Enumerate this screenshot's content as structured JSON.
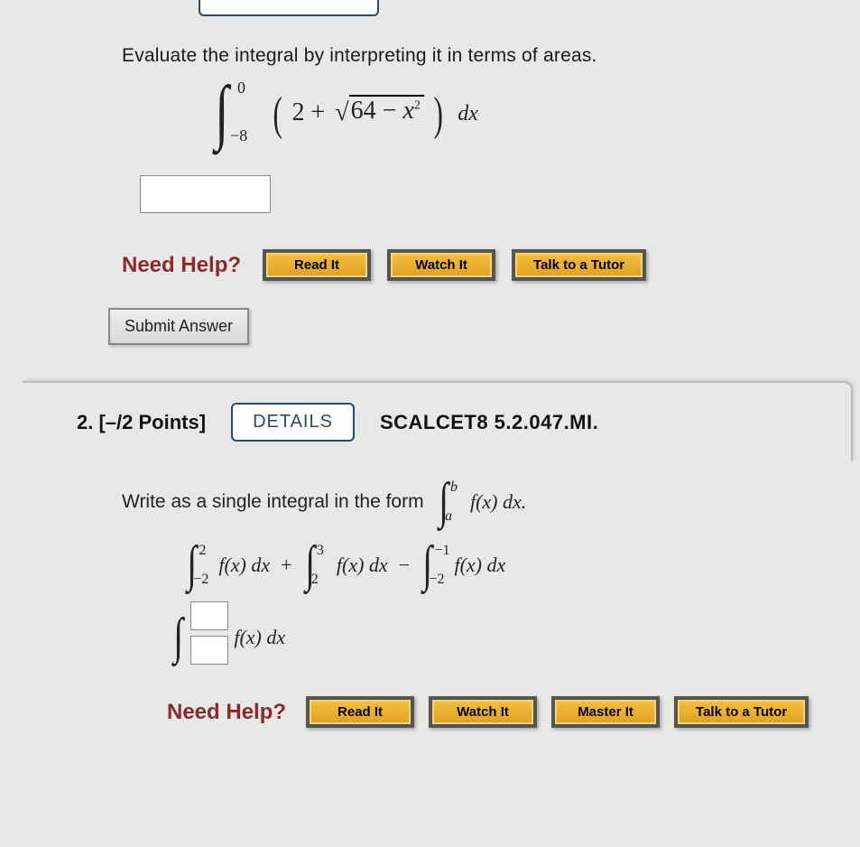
{
  "q1": {
    "prompt": "Evaluate the integral by interpreting it in terms of areas.",
    "integral": {
      "lower": "−8",
      "upper": "0",
      "const": "2",
      "plus": "+",
      "radicand_a": "64",
      "minus": "−",
      "radicand_var": "x",
      "radicand_exp": "2",
      "dx": "dx"
    },
    "need_help_label": "Need Help?",
    "buttons": {
      "read": "Read It",
      "watch": "Watch It",
      "tutor": "Talk to a Tutor"
    },
    "submit": "Submit Answer"
  },
  "q2": {
    "number": "2.",
    "points": "[–/2 Points]",
    "details": "DETAILS",
    "code": "SCALCET8 5.2.047.MI.",
    "prompt": "Write as a single integral in the form",
    "form_integral": {
      "upper": "b",
      "lower": "a",
      "integrand": "f(x) dx."
    },
    "expr": {
      "t1": {
        "lower": "−2",
        "upper": "2",
        "integrand": "f(x) dx"
      },
      "plus": "+",
      "t2": {
        "lower": "2",
        "upper": "3",
        "integrand": "f(x) dx"
      },
      "minus": "−",
      "t3": {
        "lower": "−2",
        "upper": "−1",
        "integrand": "f(x) dx"
      }
    },
    "answer_integrand": "f(x) dx",
    "need_help_label": "Need Help?",
    "buttons": {
      "read": "Read It",
      "watch": "Watch It",
      "master": "Master It",
      "tutor": "Talk to a Tutor"
    }
  }
}
